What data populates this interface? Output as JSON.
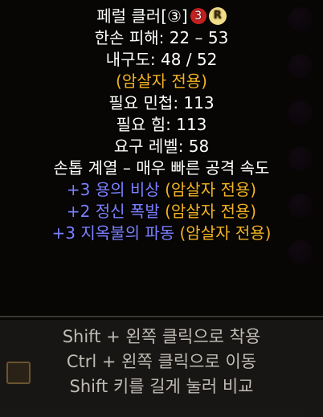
{
  "item": {
    "name": "페럴 클러",
    "bracket_label": "[③]",
    "red_badge": "3",
    "gold_badge": "R",
    "stats": [
      {
        "text": "한손 피해: 22 – 53",
        "color": "white"
      },
      {
        "text": "내구도: 48 / 52",
        "color": "white"
      },
      {
        "text": "(암살자 전용)",
        "color": "gold"
      },
      {
        "text": "필요 민첩: 113",
        "color": "white"
      },
      {
        "text": "필요 힘: 113",
        "color": "white"
      },
      {
        "text": "요구 레벨: 58",
        "color": "white"
      },
      {
        "text": "손톱 계열 – 매우 빠른 공격 속도",
        "color": "white"
      }
    ],
    "skills": [
      {
        "bonus": "+3 용의 비상",
        "restriction": "(암살자 전용)"
      },
      {
        "bonus": "+2 정신 폭발",
        "restriction": "(암살자 전용)"
      },
      {
        "bonus": "+3 지옥불의 파동",
        "restriction": "(암살자 전용)"
      }
    ]
  },
  "hints": [
    "Shift + 왼쪽 클릭으로 착용",
    "Ctrl + 왼쪽 클릭으로 이동",
    "Shift 키를 길게 눌러 비교"
  ],
  "colors": {
    "white": "#ffffff",
    "gold": "#f2b322",
    "blue": "#7b80ff",
    "red_badge": "#c42020",
    "hint": "#bfbbb5"
  }
}
